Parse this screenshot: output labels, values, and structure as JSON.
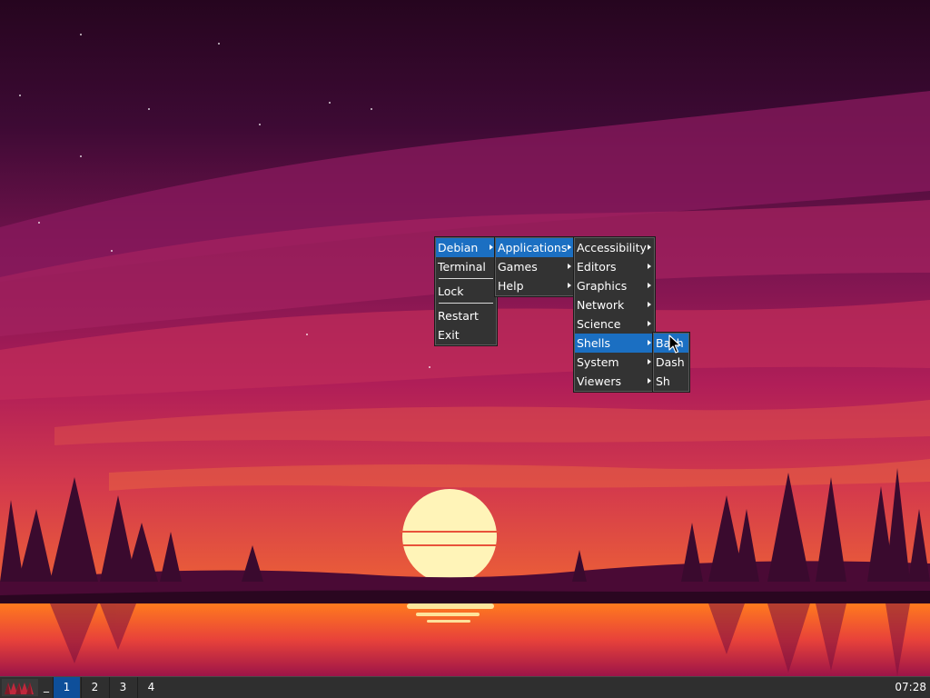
{
  "menus": {
    "root": {
      "items": [
        {
          "label": "Debian"
        },
        {
          "label": "Terminal"
        },
        {
          "label": "Lock"
        },
        {
          "label": "Restart"
        },
        {
          "label": "Exit"
        }
      ]
    },
    "debian": {
      "items": [
        {
          "label": "Applications"
        },
        {
          "label": "Games"
        },
        {
          "label": "Help"
        }
      ]
    },
    "applications": {
      "items": [
        {
          "label": "Accessibility"
        },
        {
          "label": "Editors"
        },
        {
          "label": "Graphics"
        },
        {
          "label": "Network"
        },
        {
          "label": "Science"
        },
        {
          "label": "Shells"
        },
        {
          "label": "System"
        },
        {
          "label": "Viewers"
        }
      ]
    },
    "shells": {
      "items": [
        {
          "label": "Bash"
        },
        {
          "label": "Dash"
        },
        {
          "label": "Sh"
        }
      ]
    }
  },
  "taskbar": {
    "iconify_label": "_",
    "workspaces": [
      "1",
      "2",
      "3",
      "4"
    ],
    "active_workspace": "1",
    "clock": "07:28"
  },
  "colors": {
    "menu_bg": "#333333",
    "menu_highlight": "#1b6fc2",
    "taskbar_bg": "#2f2f2f",
    "active_workspace": "#0e4f9a"
  },
  "icons": {
    "start_button": "jwm-logo-icon",
    "cursor": "mouse-pointer-icon",
    "submenu": "submenu-arrow-icon"
  }
}
